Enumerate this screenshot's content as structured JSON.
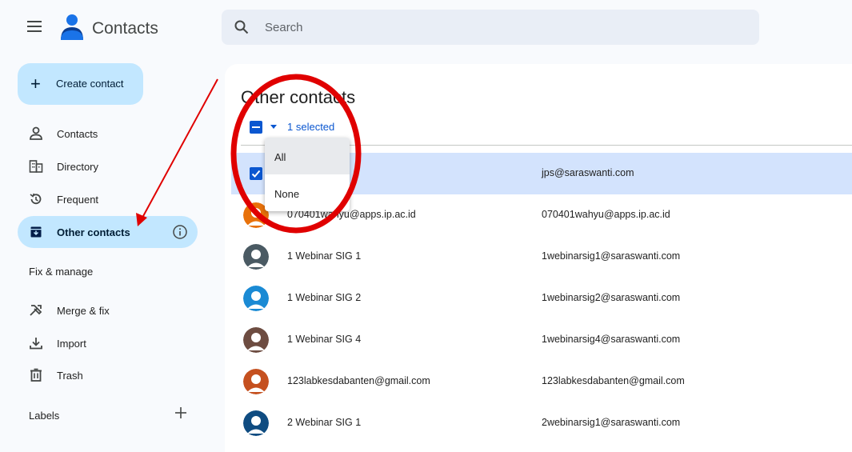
{
  "header": {
    "app_title": "Contacts",
    "search": {
      "placeholder": "Search",
      "value": ""
    }
  },
  "sidebar": {
    "create_button": "Create contact",
    "nav": [
      {
        "label": "Contacts",
        "icon": "person-icon"
      },
      {
        "label": "Directory",
        "icon": "directory-icon"
      },
      {
        "label": "Frequent",
        "icon": "history-icon"
      },
      {
        "label": "Other contacts",
        "icon": "archive-icon",
        "active": true
      }
    ],
    "fix_manage_title": "Fix & manage",
    "fix_items": [
      {
        "label": "Merge & fix",
        "icon": "merge-fix-icon"
      },
      {
        "label": "Import",
        "icon": "import-icon"
      },
      {
        "label": "Trash",
        "icon": "trash-icon"
      }
    ],
    "labels_title": "Labels"
  },
  "main": {
    "title": "Other contacts",
    "selection_text": "1 selected",
    "dropdown": [
      "All",
      "None"
    ],
    "rows": [
      {
        "name": "",
        "email": "jps@saraswanti.com",
        "selected": true,
        "color": "#0b57d0"
      },
      {
        "name": "070401wahyu@apps.ip.ac.id",
        "email": "070401wahyu@apps.ip.ac.id",
        "color": "#e8710a"
      },
      {
        "name": "1 Webinar SIG 1",
        "email": "1webinarsig1@saraswanti.com",
        "color": "#4a5a63"
      },
      {
        "name": "1 Webinar SIG 2",
        "email": "1webinarsig2@saraswanti.com",
        "color": "#1a8ad4"
      },
      {
        "name": "1 Webinar SIG 4",
        "email": "1webinarsig4@saraswanti.com",
        "color": "#6d4c41"
      },
      {
        "name": "123labkesdabanten@gmail.com",
        "email": "123labkesdabanten@gmail.com",
        "color": "#c5501f"
      },
      {
        "name": "2 Webinar SIG 1",
        "email": "2webinarsig1@saraswanti.com",
        "color": "#0f4c81"
      }
    ]
  },
  "colors": {
    "accent": "#0b57d0",
    "active_nav": "#c2e7ff",
    "selected_row": "#d3e3fd",
    "annotation": "#e00000"
  }
}
